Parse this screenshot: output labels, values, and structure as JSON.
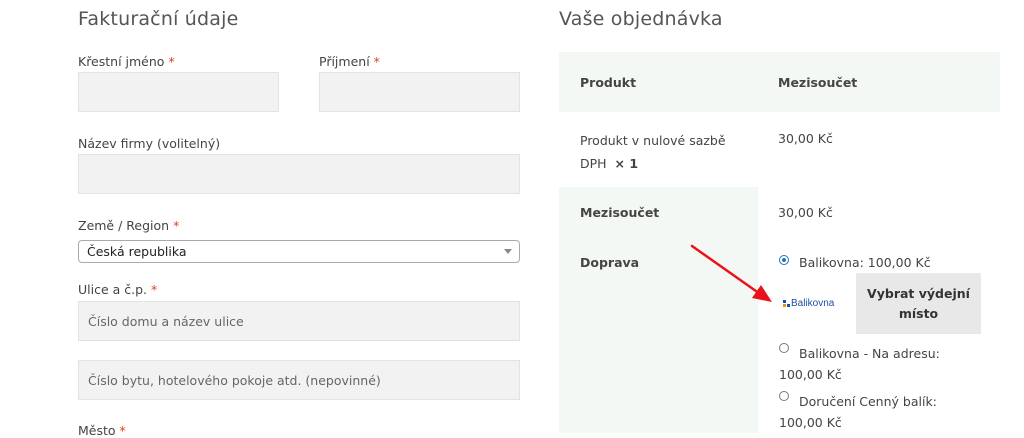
{
  "billing": {
    "heading": "Fakturační údaje",
    "first_name_label": "Křestní jméno",
    "last_name_label": "Příjmení",
    "company_label": "Název firmy (volitelný)",
    "country_label": "Země / Region",
    "country_value": "Česká republika",
    "street_label": "Ulice a č.p.",
    "address1_placeholder": "Číslo domu a název ulice",
    "address2_placeholder": "Číslo bytu, hotelového pokoje atd. (nepovinné)",
    "city_label": "Město",
    "required_mark": "*"
  },
  "order": {
    "heading": "Vaše objednávka",
    "col_product": "Produkt",
    "col_subtotal": "Mezisoučet",
    "product_name_line1": "Produkt v nulové sazbě",
    "product_name_line2": "DPH",
    "product_qty": "× 1",
    "product_price": "30,00 Kč",
    "subtotal_label": "Mezisoučet",
    "subtotal_value": "30,00 Kč",
    "shipping_label": "Doprava",
    "shipping_options": [
      {
        "label": "Balikovna: 100,00 Kč",
        "checked": true
      },
      {
        "label_line1": "Balikovna - Na adresu:",
        "label_line2": "100,00 Kč",
        "checked": false
      },
      {
        "label_line1": "Doručení Cenný balík:",
        "label_line2": "100,00 Kč",
        "checked": false
      }
    ],
    "logo_text": "Balikovna",
    "pickup_button_line1": "Vybrat výdejní",
    "pickup_button_line2": "místo"
  },
  "colors": {
    "required": "#e2401c",
    "table_tint": "#f4f8f4",
    "arrow": "#e8121b",
    "radio_accent": "#1e73be"
  }
}
